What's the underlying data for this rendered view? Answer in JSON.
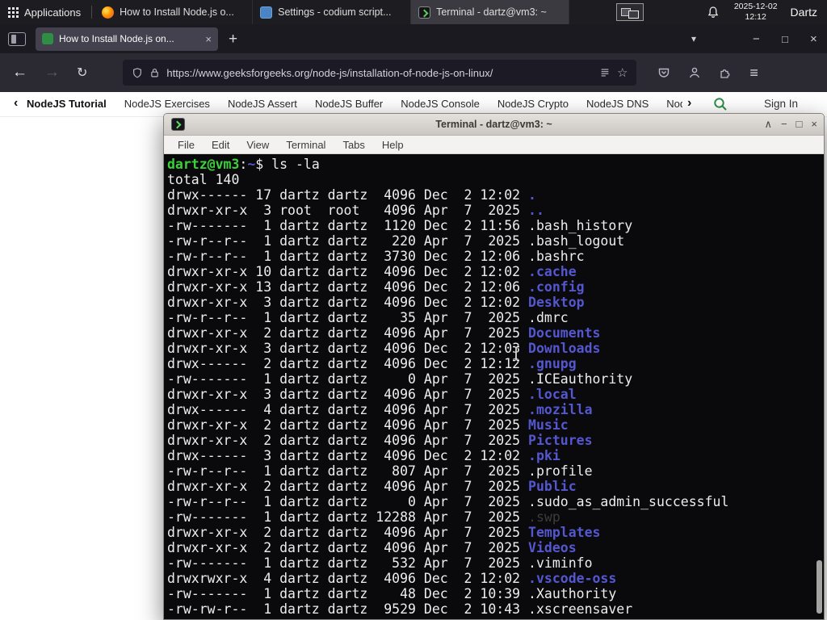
{
  "colors": {
    "panel-bg": "#1d1d21",
    "tabstrip-bg": "#1b1a21",
    "tab-bg": "#42414d",
    "toolbar-bg": "#2b2a33",
    "urlbar-bg": "#1c1b25",
    "accent-green": "#2f8d46",
    "term-bg": "#0a0a0c",
    "term-fg": "#ededed",
    "dir-blue": "#5457cf",
    "prompt-green": "#3bd13b",
    "dim-gray": "#3c3c3c"
  },
  "icons": {
    "back": "←",
    "forward": "→",
    "reload": "↻",
    "new_tab": "+",
    "tab_close": "×",
    "list_tabs": "▾",
    "window_minimize": "−",
    "window_maximize": "□",
    "window_close": "×",
    "menu": "≡",
    "star": "☆",
    "shade": "∧",
    "terminal_minimize": "−",
    "terminal_maximize": "□",
    "terminal_close": "×",
    "chevron_left": "‹",
    "chevron_right": "›"
  },
  "panel": {
    "applications_label": "Applications",
    "tasks": [
      {
        "label": "How to Install Node.js o...",
        "icon": "firefox",
        "active": false
      },
      {
        "label": "Settings - codium script...",
        "icon": "settings",
        "active": false
      },
      {
        "label": "Terminal - dartz@vm3: ~",
        "icon": "terminal",
        "active": true
      }
    ],
    "clock_date": "2025-12-02",
    "clock_time": "12:12",
    "user": "Dartz"
  },
  "browser": {
    "tab_title": "How to Install Node.js on...",
    "url": "https://www.geeksforgeeks.org/node-js/installation-of-node-js-on-linux/",
    "gfg_links": [
      "NodeJS Tutorial",
      "NodeJS Exercises",
      "NodeJS Assert",
      "NodeJS Buffer",
      "NodeJS Console",
      "NodeJS Crypto",
      "NodeJS DNS",
      "Node"
    ],
    "sign_in": "Sign In"
  },
  "terminal": {
    "title": "Terminal - dartz@vm3: ~",
    "menus": [
      "File",
      "Edit",
      "View",
      "Terminal",
      "Tabs",
      "Help"
    ],
    "prompt": {
      "user_host": "dartz@vm3",
      "separator": ":",
      "path": "~",
      "symbol": "$",
      "command": "ls -la"
    },
    "total": "total 140",
    "listing": [
      {
        "pre": "drwx------ 17 dartz dartz  4096 Dec  2 12:02 ",
        "name": ".",
        "type": "dir"
      },
      {
        "pre": "drwxr-xr-x  3 root  root   4096 Apr  7  2025 ",
        "name": "..",
        "type": "dir"
      },
      {
        "pre": "-rw-------  1 dartz dartz  1120 Dec  2 11:56 ",
        "name": ".bash_history",
        "type": "file"
      },
      {
        "pre": "-rw-r--r--  1 dartz dartz   220 Apr  7  2025 ",
        "name": ".bash_logout",
        "type": "file"
      },
      {
        "pre": "-rw-r--r--  1 dartz dartz  3730 Dec  2 12:06 ",
        "name": ".bashrc",
        "type": "file"
      },
      {
        "pre": "drwxr-xr-x 10 dartz dartz  4096 Dec  2 12:02 ",
        "name": ".cache",
        "type": "dir"
      },
      {
        "pre": "drwxr-xr-x 13 dartz dartz  4096 Dec  2 12:06 ",
        "name": ".config",
        "type": "dir"
      },
      {
        "pre": "drwxr-xr-x  3 dartz dartz  4096 Dec  2 12:02 ",
        "name": "Desktop",
        "type": "dir"
      },
      {
        "pre": "-rw-r--r--  1 dartz dartz    35 Apr  7  2025 ",
        "name": ".dmrc",
        "type": "file"
      },
      {
        "pre": "drwxr-xr-x  2 dartz dartz  4096 Apr  7  2025 ",
        "name": "Documents",
        "type": "dir"
      },
      {
        "pre": "drwxr-xr-x  3 dartz dartz  4096 Dec  2 12:03 ",
        "name": "Downloads",
        "type": "dir"
      },
      {
        "pre": "drwx------  2 dartz dartz  4096 Dec  2 12:12 ",
        "name": ".gnupg",
        "type": "dir"
      },
      {
        "pre": "-rw-------  1 dartz dartz     0 Apr  7  2025 ",
        "name": ".ICEauthority",
        "type": "file"
      },
      {
        "pre": "drwxr-xr-x  3 dartz dartz  4096 Apr  7  2025 ",
        "name": ".local",
        "type": "dir"
      },
      {
        "pre": "drwx------  4 dartz dartz  4096 Apr  7  2025 ",
        "name": ".mozilla",
        "type": "dir"
      },
      {
        "pre": "drwxr-xr-x  2 dartz dartz  4096 Apr  7  2025 ",
        "name": "Music",
        "type": "dir"
      },
      {
        "pre": "drwxr-xr-x  2 dartz dartz  4096 Apr  7  2025 ",
        "name": "Pictures",
        "type": "dir"
      },
      {
        "pre": "drwx------  3 dartz dartz  4096 Dec  2 12:02 ",
        "name": ".pki",
        "type": "dir"
      },
      {
        "pre": "-rw-r--r--  1 dartz dartz   807 Apr  7  2025 ",
        "name": ".profile",
        "type": "file"
      },
      {
        "pre": "drwxr-xr-x  2 dartz dartz  4096 Apr  7  2025 ",
        "name": "Public",
        "type": "dir"
      },
      {
        "pre": "-rw-r--r--  1 dartz dartz     0 Apr  7  2025 ",
        "name": ".sudo_as_admin_successful",
        "type": "file"
      },
      {
        "pre": "-rw-------  1 dartz dartz 12288 Apr  7  2025 ",
        "name": ".swp",
        "type": "dim"
      },
      {
        "pre": "drwxr-xr-x  2 dartz dartz  4096 Apr  7  2025 ",
        "name": "Templates",
        "type": "dir"
      },
      {
        "pre": "drwxr-xr-x  2 dartz dartz  4096 Apr  7  2025 ",
        "name": "Videos",
        "type": "dir"
      },
      {
        "pre": "-rw-------  1 dartz dartz   532 Apr  7  2025 ",
        "name": ".viminfo",
        "type": "file"
      },
      {
        "pre": "drwxrwxr-x  4 dartz dartz  4096 Dec  2 12:02 ",
        "name": ".vscode-oss",
        "type": "dir"
      },
      {
        "pre": "-rw-------  1 dartz dartz    48 Dec  2 10:39 ",
        "name": ".Xauthority",
        "type": "file"
      },
      {
        "pre": "-rw-rw-r--  1 dartz dartz  9529 Dec  2 10:43 ",
        "name": ".xscreensaver",
        "type": "file"
      }
    ]
  }
}
